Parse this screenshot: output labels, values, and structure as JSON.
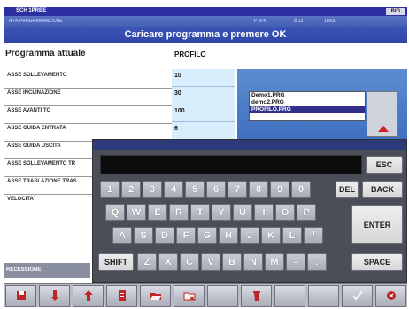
{
  "titlebar": {
    "app_name": "SCH 1PRBE",
    "window_buttons": "BIG"
  },
  "statusbar": {
    "left": "A I K  PROGRAMMAZIONE",
    "mid1": "P M  4",
    "mid2": "B 13",
    "right": "18000"
  },
  "banner": "Caricare programma e premere OK",
  "program": {
    "label": "Programma attuale",
    "value": "PROFILO"
  },
  "params": [
    {
      "label": "ASSE SOLLEVAMENTO",
      "value": "10"
    },
    {
      "label": "ASSE INCLINAZIONE",
      "value": "30"
    },
    {
      "label": "ASSE AVANTI TO",
      "value": "100"
    },
    {
      "label": "ASSE GUIDA ENTRATA",
      "value": "6"
    },
    {
      "label": "ASSE GUIDA USCITA",
      "value": ""
    },
    {
      "label": "ASSE SOLLEVAMENTO TR",
      "value": ""
    },
    {
      "label": "ASSE TRASLAZIONE TRAS",
      "value": ""
    },
    {
      "label": "VELOCITA'",
      "value": ""
    }
  ],
  "bottom_label": "RECESSIONE",
  "file_list": {
    "items": [
      "Demo1.PRG",
      "demo2.PRG",
      "PROFILO.PRG"
    ],
    "selected_index": 2
  },
  "keyboard": {
    "input_value": "",
    "esc": "ESC",
    "digits": [
      "1",
      "2",
      "3",
      "4",
      "5",
      "6",
      "7",
      "8",
      "9",
      "0"
    ],
    "del": "DEL",
    "back": "BACK",
    "row_q": [
      "Q",
      "W",
      "E",
      "R",
      "T",
      "Y",
      "U",
      "I",
      "O",
      "P"
    ],
    "row_a": [
      "A",
      "S",
      "D",
      "F",
      "G",
      "H",
      "J",
      "K",
      "L",
      "/"
    ],
    "row_z": [
      "Z",
      "X",
      "C",
      "V",
      "B",
      "N",
      "M",
      "-",
      "."
    ],
    "enter": "ENTER",
    "shift": "SHIFT",
    "space": "SPACE"
  },
  "toolbar": [
    {
      "icon": "save-icon",
      "label": ""
    },
    {
      "icon": "arrow-down-icon",
      "label": ""
    },
    {
      "icon": "arrow-up-icon",
      "label": ""
    },
    {
      "icon": "document-icon",
      "label": ""
    },
    {
      "icon": "folder-open-icon",
      "label": ""
    },
    {
      "icon": "folder-delete-icon",
      "label": ""
    },
    {
      "icon": "blank",
      "label": ""
    },
    {
      "icon": "delete-icon",
      "label": ""
    },
    {
      "icon": "blank",
      "label": ""
    },
    {
      "icon": "blank",
      "label": ""
    },
    {
      "icon": "ok-icon",
      "label": ""
    },
    {
      "icon": "exit-icon",
      "label": ""
    }
  ],
  "colors": {
    "accent": "#2f46a6",
    "selection": "#30308a",
    "keyboard_bg": "#4a4e57",
    "value_bg": "#d8eefc"
  }
}
